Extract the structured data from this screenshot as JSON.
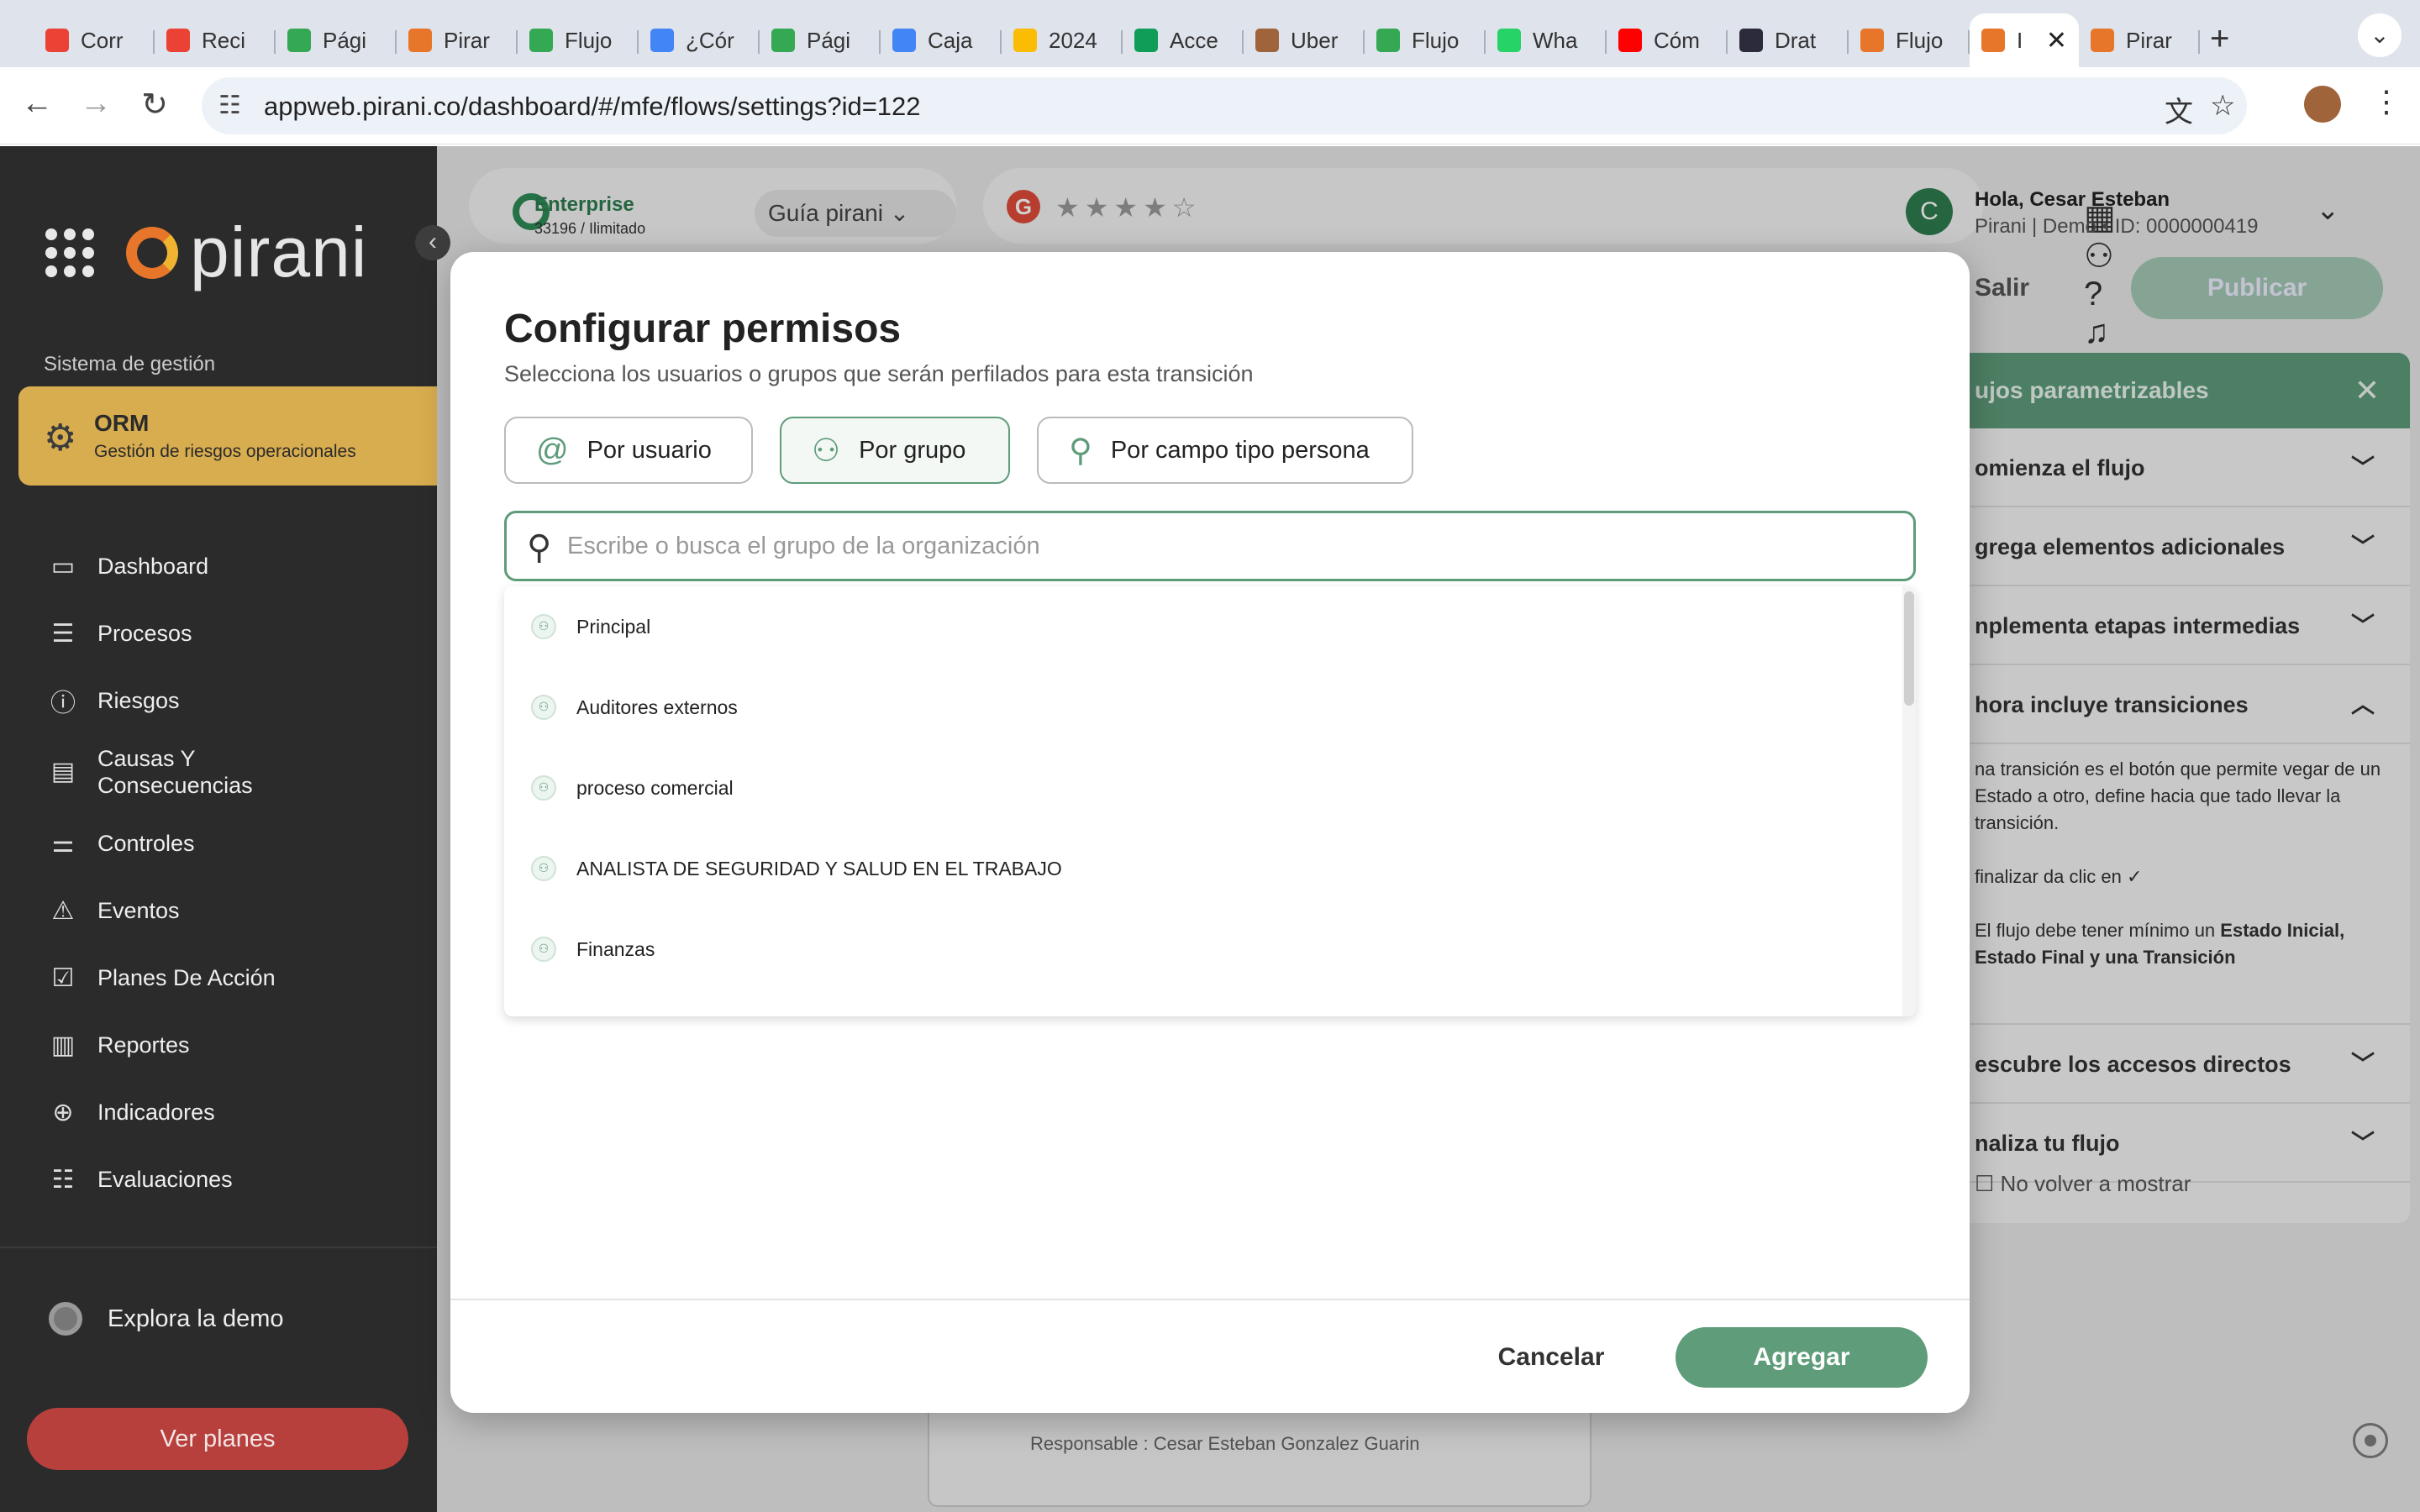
{
  "browser": {
    "tabs": [
      {
        "label": "Corr",
        "color": "#ea4335"
      },
      {
        "label": "Reci",
        "color": "#ea4335"
      },
      {
        "label": "Pági",
        "color": "#34a853"
      },
      {
        "label": "Pirar",
        "color": "#e8762a"
      },
      {
        "label": "Flujo",
        "color": "#34a853"
      },
      {
        "label": "¿Cór",
        "color": "#4285f4"
      },
      {
        "label": "Pági",
        "color": "#34a853"
      },
      {
        "label": "Caja",
        "color": "#4285f4"
      },
      {
        "label": "2024",
        "color": "#fbbc04"
      },
      {
        "label": "Acce",
        "color": "#0f9d58"
      },
      {
        "label": "Uber",
        "color": "#a0643a"
      },
      {
        "label": "Flujo",
        "color": "#34a853"
      },
      {
        "label": "Wha",
        "color": "#25d366"
      },
      {
        "label": "Cóm",
        "color": "#ff0000"
      },
      {
        "label": "Drat",
        "color": "#2b2b3b"
      },
      {
        "label": "Flujo",
        "color": "#e8762a"
      },
      {
        "label": "I",
        "color": "#e8762a"
      },
      {
        "label": "Pirar",
        "color": "#e8762a"
      }
    ],
    "active_tab_index": 16,
    "url": "appweb.pirani.co/dashboard/#/mfe/flows/settings?id=122"
  },
  "sidebar": {
    "brand": "pirani",
    "section_label": "Sistema de gestión",
    "module": {
      "title": "ORM",
      "subtitle": "Gestión de riesgos operacionales"
    },
    "items": [
      {
        "label": "Dashboard",
        "icon": "monitor-icon"
      },
      {
        "label": "Procesos",
        "icon": "list-icon"
      },
      {
        "label": "Riesgos",
        "icon": "alert-circle-icon"
      },
      {
        "label": "Causas Y Consecuencias",
        "icon": "clipboard-icon"
      },
      {
        "label": "Controles",
        "icon": "sliders-icon"
      },
      {
        "label": "Eventos",
        "icon": "warning-icon"
      },
      {
        "label": "Planes De Acción",
        "icon": "checkbox-icon"
      },
      {
        "label": "Reportes",
        "icon": "bar-chart-icon"
      },
      {
        "label": "Indicadores",
        "icon": "crosshair-icon"
      },
      {
        "label": "Evaluaciones",
        "icon": "checklist-icon"
      }
    ],
    "demo_label": "Explora la demo",
    "plans_button": "Ver planes"
  },
  "header": {
    "plan_name": "Enterprise",
    "plan_detail": "33196 / Ilimitado",
    "guide_label": "Guía pirani",
    "user_greeting": "Hola, Cesar Esteban",
    "user_detail": "Pirani | Demo • ID: 0000000419",
    "user_initial": "C"
  },
  "page": {
    "exit_label": "Salir",
    "publish_label": "Publicar",
    "responsible_text": "Responsable : Cesar Esteban  Gonzalez Guarin"
  },
  "guide": {
    "title": "ujos parametrizables",
    "sections": [
      "omienza el flujo",
      "grega elementos adicionales",
      "nplementa etapas intermedias",
      "hora incluye transiciones"
    ],
    "body_1": "na transición es el botón que permite vegar de un Estado a otro, define hacia que tado llevar la transición.",
    "body_2": "finalizar da clic en ✓",
    "body_3_pre": "El flujo debe tener mínimo un ",
    "body_3_bold_1": "Estado Inicial,",
    "body_3_bold_2": "Estado Final y una Transición",
    "sections_after": [
      "escubre los accesos directos",
      "naliza tu flujo"
    ],
    "no_show": "No volver a mostrar"
  },
  "modal": {
    "title": "Configurar permisos",
    "subtitle": "Selecciona los usuarios o grupos que serán perfilados para esta transición",
    "options": [
      {
        "label": "Por usuario",
        "icon": "at-icon"
      },
      {
        "label": "Por grupo",
        "icon": "group-icon"
      },
      {
        "label": "Por campo tipo persona",
        "icon": "person-icon"
      }
    ],
    "selected_option": "Por grupo",
    "search_placeholder": "Escribe o busca el grupo de la organización",
    "search_value": "",
    "groups": [
      "Principal",
      "Auditores externos",
      "proceso comercial",
      "ANALISTA DE SEGURIDAD Y SALUD EN EL TRABAJO",
      "Finanzas"
    ],
    "cancel_label": "Cancelar",
    "add_label": "Agregar"
  }
}
